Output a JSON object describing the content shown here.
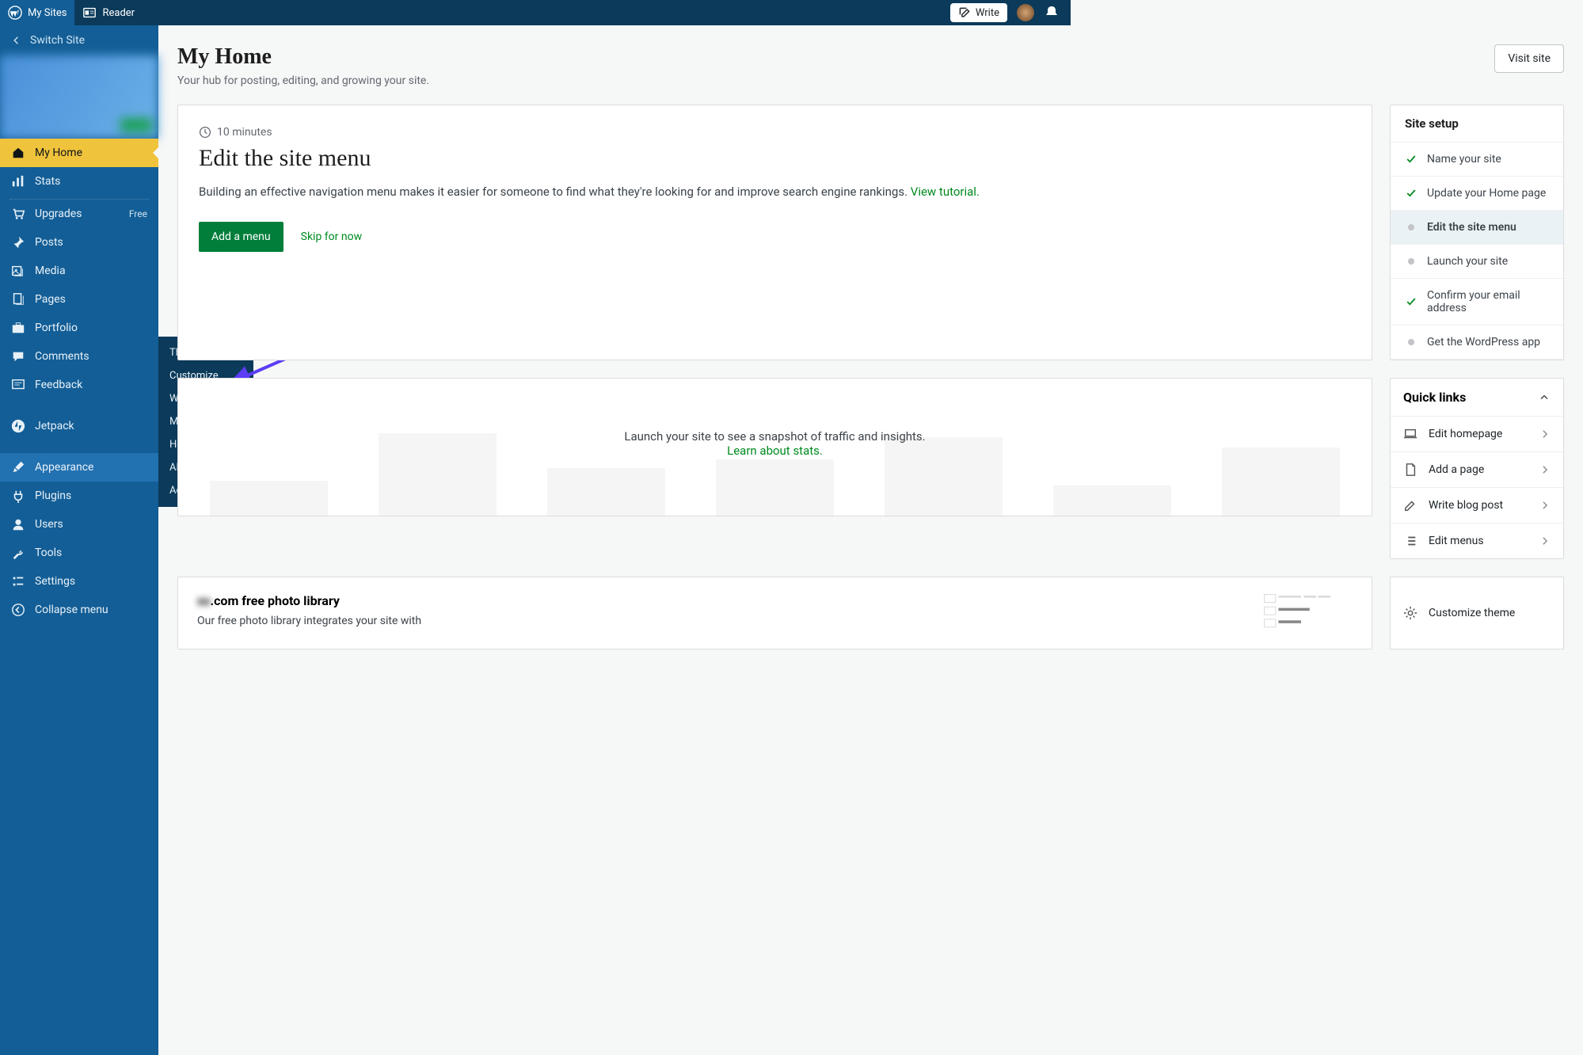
{
  "topbar": {
    "my_sites": "My Sites",
    "reader": "Reader",
    "write": "Write"
  },
  "sidebar": {
    "switch": "Switch Site",
    "items": [
      {
        "label": "My Home",
        "icon": "home",
        "current": true
      },
      {
        "label": "Stats",
        "icon": "stats"
      },
      {
        "label": "Upgrades",
        "icon": "cart",
        "badge": "Free"
      },
      {
        "label": "Posts",
        "icon": "pin"
      },
      {
        "label": "Media",
        "icon": "media"
      },
      {
        "label": "Pages",
        "icon": "pages"
      },
      {
        "label": "Portfolio",
        "icon": "portfolio"
      },
      {
        "label": "Comments",
        "icon": "comments"
      },
      {
        "label": "Feedback",
        "icon": "feedback"
      },
      {
        "label": "Jetpack",
        "icon": "jetpack",
        "sep_before": true
      },
      {
        "label": "Appearance",
        "icon": "brush",
        "hover": true,
        "sep_before": true
      },
      {
        "label": "Plugins",
        "icon": "plug"
      },
      {
        "label": "Users",
        "icon": "user"
      },
      {
        "label": "Tools",
        "icon": "wrench"
      },
      {
        "label": "Settings",
        "icon": "settings"
      },
      {
        "label": "Collapse menu",
        "icon": "collapse"
      }
    ]
  },
  "flyout": {
    "items": [
      "Themes",
      "Customize",
      "Widgets",
      "Menus",
      "Header",
      "AMP",
      "Additional CSS"
    ]
  },
  "page": {
    "title": "My Home",
    "subtitle": "Your hub for posting, editing, and growing your site.",
    "visit": "Visit site"
  },
  "task": {
    "duration": "10 minutes",
    "title": "Edit the site menu",
    "desc": "Building an effective navigation menu makes it easier for someone to find what they're looking for and improve search engine rankings. ",
    "link": "View tutorial.",
    "primary": "Add a menu",
    "skip": "Skip for now"
  },
  "setup": {
    "title": "Site setup",
    "items": [
      {
        "label": "Name your site",
        "done": true
      },
      {
        "label": "Update your Home page",
        "done": true
      },
      {
        "label": "Edit the site menu",
        "active": true
      },
      {
        "label": "Launch your site"
      },
      {
        "label": "Confirm your email address",
        "done": true
      },
      {
        "label": "Get the WordPress app"
      }
    ]
  },
  "stats": {
    "text": "Launch your site to see a snapshot of traffic and insights. ",
    "link": "Learn about stats."
  },
  "quick": {
    "title": "Quick links",
    "items": [
      {
        "label": "Edit homepage",
        "icon": "laptop"
      },
      {
        "label": "Add a page",
        "icon": "page"
      },
      {
        "label": "Write blog post",
        "icon": "pencil"
      },
      {
        "label": "Edit menus",
        "icon": "list"
      }
    ],
    "customize": "Customize theme"
  },
  "photo": {
    "title_suffix": ".com free photo library",
    "desc": "Our free photo library integrates your site with"
  }
}
